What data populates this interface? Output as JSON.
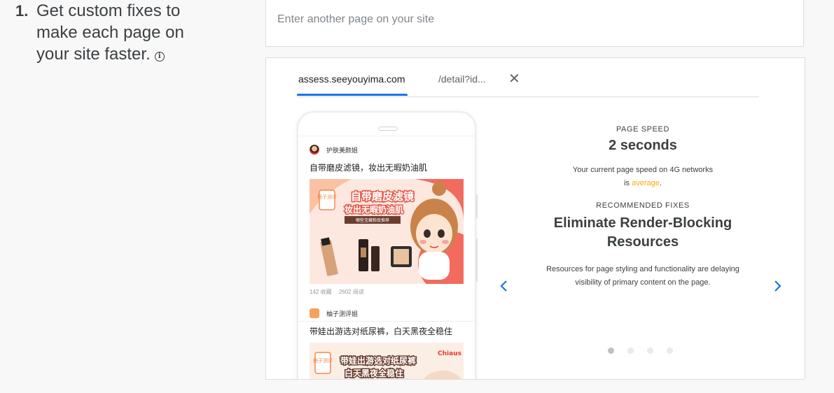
{
  "step": {
    "number": "1.",
    "text": "Get custom fixes to make each page on your site faster."
  },
  "search": {
    "placeholder": "Enter another page on your site",
    "value": ""
  },
  "tabs": [
    {
      "label": "assess.seeyouyima.com",
      "active": true
    },
    {
      "label": "/detail?id...",
      "active": false
    }
  ],
  "close_glyph": "✕",
  "phone": {
    "posts": [
      {
        "author": "护肤美颜姐",
        "title": "自带磨皮滤镜，妆出无暇奶油肌",
        "image_text_1": "自带磨皮滤镜",
        "image_text_2": "妆出无暇奶油肌",
        "image_text_3": "哪些宝藏粉底推荐",
        "badge": "柚子测评",
        "collects": "142 收藏",
        "reads": "2602 阅读"
      },
      {
        "author": "柚子测评姐",
        "title": "带娃出游选对纸尿裤，白天黑夜全稳住",
        "image_text_1": "带娃出游选对纸尿裤",
        "image_text_2": "白天黑夜全稳住",
        "badge": "柚子测评",
        "brand": "Chiaus"
      }
    ]
  },
  "speed": {
    "label": "PAGE SPEED",
    "value": "2 seconds",
    "desc_line1": "Your current page speed on 4G networks",
    "desc_prefix": "is ",
    "rating": "average",
    "desc_suffix": ".",
    "rating_color": "#f9ab00"
  },
  "fixes": {
    "label": "RECOMMENDED FIXES",
    "title_line1": "Eliminate Render-Blocking",
    "title_line2": "Resources",
    "desc_line1": "Resources for page styling and functionality are delaying",
    "desc_line2": "visibility of primary content on the page."
  },
  "carousel": {
    "active_index": 0,
    "count": 4,
    "arrow_color": "#1a73e8"
  }
}
